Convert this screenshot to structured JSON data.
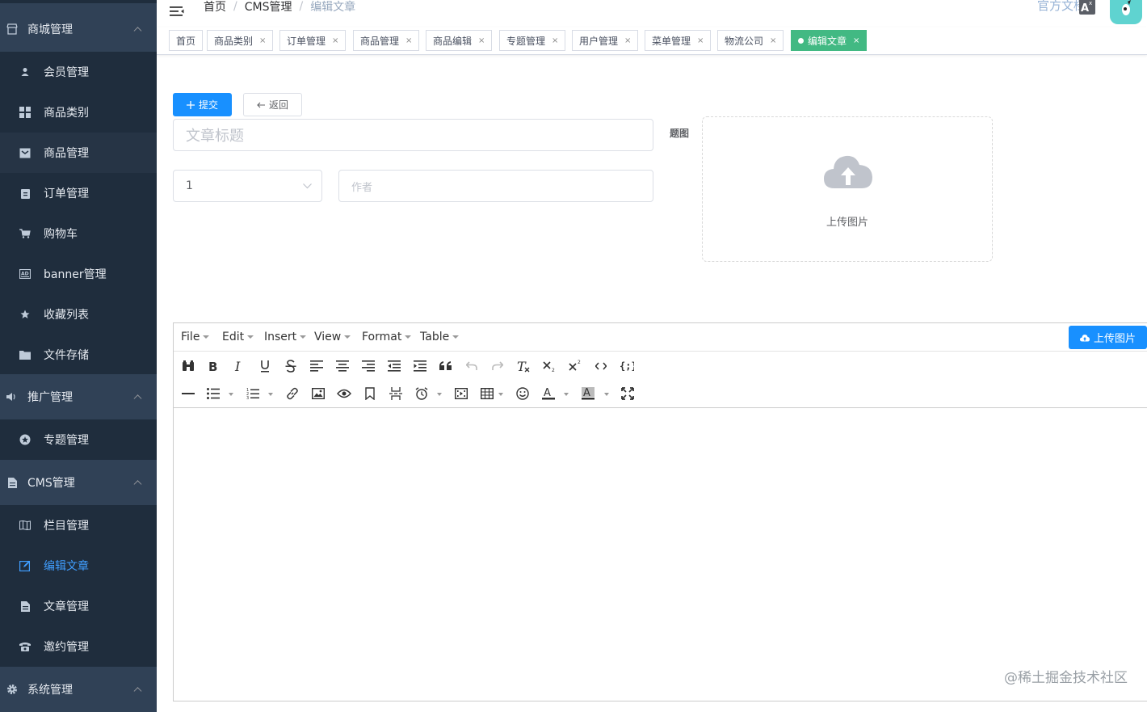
{
  "sidebar": {
    "groups": [
      {
        "label": "商城管理",
        "icon": "store-icon"
      },
      {
        "label": "推广管理",
        "icon": "sound-icon"
      },
      {
        "label": "CMS管理",
        "icon": "document-icon"
      },
      {
        "label": "系统管理",
        "icon": "gear-icon"
      }
    ],
    "mall_items": [
      {
        "label": "会员管理",
        "icon": "user-icon"
      },
      {
        "label": "商品类别",
        "icon": "grid-icon"
      },
      {
        "label": "商品管理",
        "icon": "inbox-icon"
      },
      {
        "label": "订单管理",
        "icon": "clipboard-icon"
      },
      {
        "label": "购物车",
        "icon": "cart-icon"
      },
      {
        "label": "banner管理",
        "icon": "ad-icon"
      },
      {
        "label": "收藏列表",
        "icon": "star-icon"
      },
      {
        "label": "文件存储",
        "icon": "folder-icon"
      }
    ],
    "promo_items": [
      {
        "label": "专题管理",
        "icon": "star-circle-icon"
      }
    ],
    "cms_items": [
      {
        "label": "栏目管理",
        "icon": "columns-icon"
      },
      {
        "label": "编辑文章",
        "icon": "edit-icon"
      },
      {
        "label": "文章管理",
        "icon": "article-icon"
      },
      {
        "label": "邀约管理",
        "icon": "phone-icon"
      }
    ],
    "colors": {
      "bg": "#1f2d3d",
      "group_bg": "#304156",
      "active": "#409eff"
    }
  },
  "header": {
    "breadcrumb": [
      "首页",
      "CMS管理",
      "编辑文章"
    ],
    "breadcrumb_sep": "/",
    "doc_link": "官方文档",
    "lang_icon": "translate-icon",
    "avatar_icon": "avatar-icon"
  },
  "tags": [
    {
      "label": "首页",
      "closable": false
    },
    {
      "label": "商品类别",
      "closable": true
    },
    {
      "label": "订单管理",
      "closable": true
    },
    {
      "label": "商品管理",
      "closable": true
    },
    {
      "label": "商品编辑",
      "closable": true
    },
    {
      "label": "专题管理",
      "closable": true
    },
    {
      "label": "用户管理",
      "closable": true
    },
    {
      "label": "菜单管理",
      "closable": true
    },
    {
      "label": "物流公司",
      "closable": true
    },
    {
      "label": "编辑文章",
      "closable": true,
      "active": true
    }
  ],
  "tag_close": "×",
  "form": {
    "submit_label": "提交",
    "back_label": "返回",
    "title_placeholder": "文章标题",
    "select_value": "1",
    "author_placeholder": "作者",
    "image_label": "题图",
    "upload_text": "上传图片"
  },
  "editor": {
    "menus": [
      "File",
      "Edit",
      "Insert",
      "View",
      "Format",
      "Table"
    ],
    "upload_button": "上传图片",
    "toolbar_row1": [
      "find-replace-icon",
      "bold-icon",
      "italic-icon",
      "underline-icon",
      "strikethrough-icon",
      "align-left-icon",
      "align-center-icon",
      "align-right-icon",
      "outdent-icon",
      "indent-icon",
      "blockquote-icon",
      "undo-icon",
      "redo-icon",
      "remove-format-icon",
      "subscript-icon",
      "superscript-icon",
      "code-icon",
      "code-sample-icon"
    ],
    "toolbar_row2": [
      "hr-icon",
      "bullet-list-icon",
      "number-list-icon",
      "link-icon",
      "image-icon",
      "preview-icon",
      "anchor-icon",
      "page-break-icon",
      "insert-datetime-icon",
      "media-icon",
      "table-icon",
      "emoticons-icon",
      "text-color-icon",
      "background-color-icon",
      "fullscreen-icon"
    ]
  },
  "watermark": "@稀土掘金技术社区",
  "accent": "#1890ff",
  "tag_active_color": "#42b983"
}
